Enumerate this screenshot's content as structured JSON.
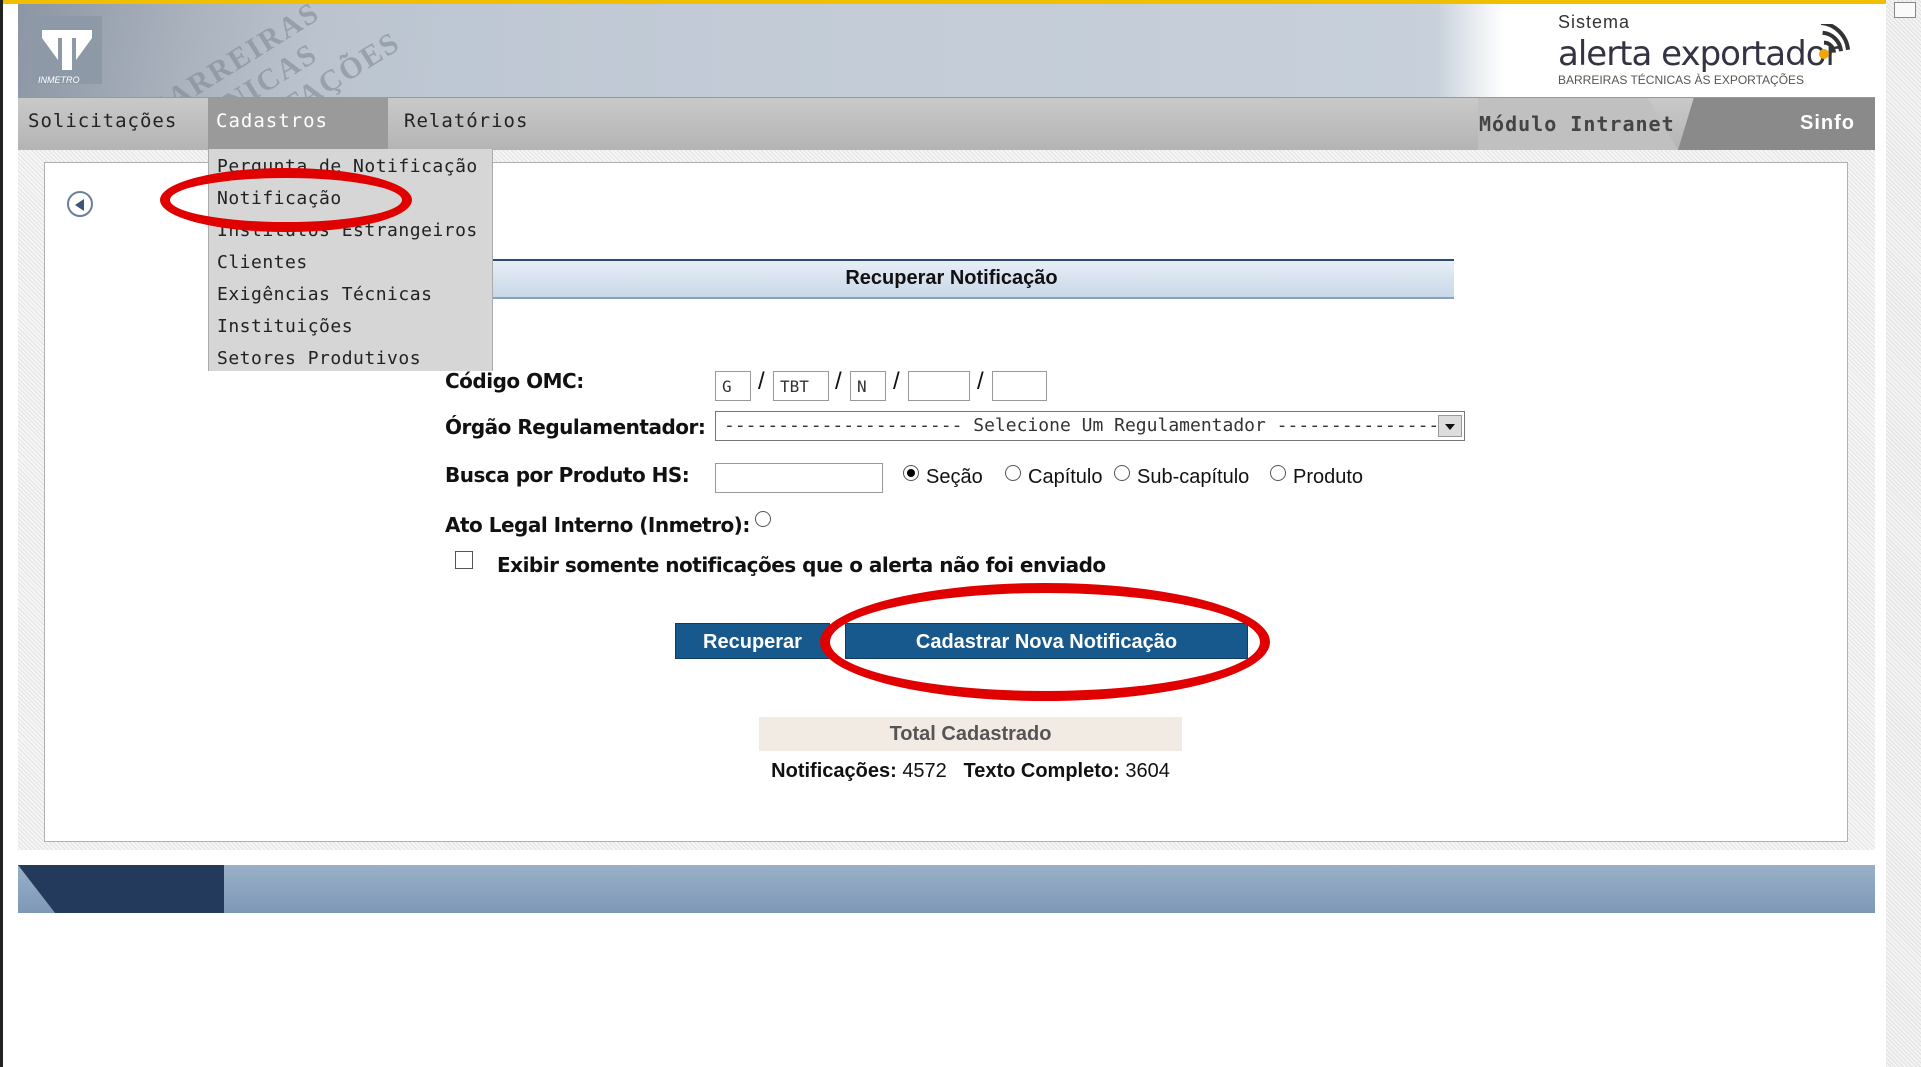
{
  "header": {
    "logo_text": "INMETRO",
    "photo_text": "BARREIRAS TÉCNICAS EXPORTAÇÕES",
    "brand": {
      "sistema": "Sistema",
      "name": "alerta exportador",
      "tagline": "BARREIRAS TÉCNICAS ÀS EXPORTAÇÕES"
    }
  },
  "menu": {
    "items": [
      "Solicitações",
      "Cadastros",
      "Relatórios"
    ],
    "active": "Cadastros",
    "modulo": "Módulo Intranet",
    "sinfo": "Sinfo"
  },
  "dropdown": {
    "items": [
      "Pergunta de Notificação",
      "Notificação",
      "Institutos Estrangeiros",
      "Clientes",
      "Exigências Técnicas",
      "Instituições",
      "Setores Produtivos"
    ]
  },
  "form": {
    "title": "Recuperar Notificação",
    "codigo_label": "Código OMC:",
    "codigo_values": [
      "G",
      "TBT",
      "N",
      "",
      ""
    ],
    "orgao_label": "Órgão Regulamentador:",
    "orgao_selected": "---------------------- Selecione Um Regulamentador ----------------",
    "busca_label": "Busca por Produto HS:",
    "busca_value": "",
    "radios": [
      "Seção",
      "Capítulo",
      "Sub-capítulo",
      "Produto"
    ],
    "radio_selected": "Seção",
    "ato_label": "Ato Legal Interno (Inmetro):",
    "checkbox_label": "Exibir somente notificações que o alerta não foi enviado",
    "btn_recuperar": "Recuperar",
    "btn_cadastrar": "Cadastrar Nova Notificação"
  },
  "totals": {
    "title": "Total Cadastrado",
    "notif_label": "Notificações:",
    "notif_value": "4572",
    "texto_label": "Texto Completo:",
    "texto_value": "3604"
  },
  "colors": {
    "button": "#17598d",
    "highlight": "#e00000",
    "menubar": "#bcbcbc"
  }
}
